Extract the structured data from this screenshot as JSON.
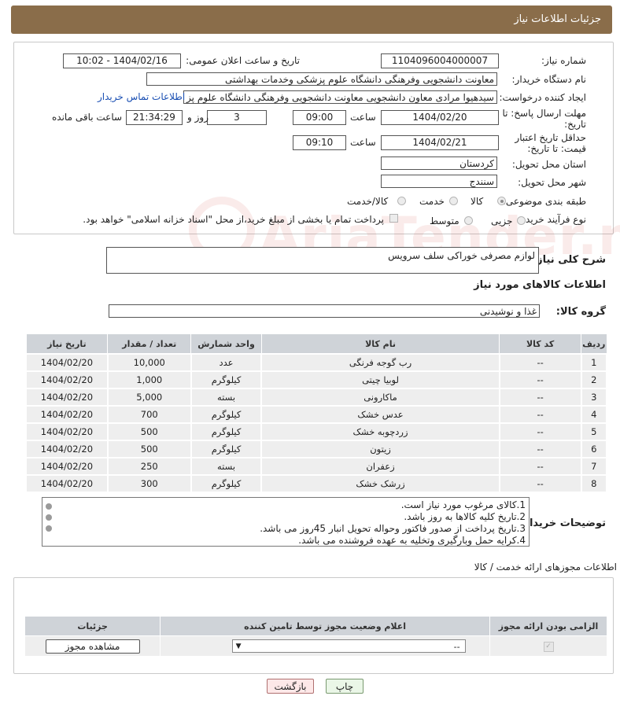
{
  "header": {
    "title": "جزئیات اطلاعات نیاز"
  },
  "form": {
    "need_number_label": "شماره نیاز:",
    "need_number": "1104096004000007",
    "announce_label": "تاریخ و ساعت اعلان عمومی:",
    "announce_value": "1404/02/16 - 10:02",
    "buyer_org_label": "نام دستگاه خریدار:",
    "buyer_org": "معاونت دانشجویی وفرهنگی دانشگاه علوم پزشکی وخدمات بهداشتی",
    "creator_label": "ایجاد کننده درخواست:",
    "creator": "سیدهیوا مرادی معاون دانشجویی معاونت دانشجویی وفرهنگی دانشگاه علوم پز",
    "contact_link": "اطلاعات تماس خریدار",
    "reply_deadline_label": "مهلت ارسال پاسخ: تا تاریخ:",
    "reply_date": "1404/02/20",
    "time_label": "ساعت",
    "reply_time": "09:00",
    "days": "3",
    "days_label": "روز و",
    "remaining_time": "21:34:29",
    "remaining_label": "ساعت باقی مانده",
    "price_validity_label": "حداقل تاریخ اعتبار قیمت: تا تاریخ:",
    "price_date": "1404/02/21",
    "price_time": "09:10",
    "province_label": "استان محل تحویل:",
    "province": "کردستان",
    "city_label": "شهر محل تحویل:",
    "city": "سنندج",
    "category_label": "طبقه بندی موضوعی:",
    "category_options": [
      "کالا",
      "خدمت",
      "کالا/خدمت"
    ],
    "process_label": "نوع فرآیند خرید :",
    "process_options": [
      "جزیی",
      "متوسط"
    ],
    "payment_note": "پرداخت تمام یا بخشی از مبلغ خرید،از محل \"اسناد خزانه اسلامی\" خواهد بود.",
    "watermark": "AriaTender.neT"
  },
  "summary": {
    "label": "شرح کلی نیاز:",
    "value": "لوازم مصرفی خوراکی سلف سرویس",
    "goods_info_title": "اطلاعات کالاهای مورد نیاز",
    "group_label": "گروه کالا:",
    "group_value": "غذا و نوشیدنی"
  },
  "items_table": {
    "headers": [
      "ردیف",
      "کد کالا",
      "نام کالا",
      "واحد شمارش",
      "تعداد / مقدار",
      "تاریخ نیاز"
    ],
    "rows": [
      [
        "1",
        "--",
        "رب گوجه فرنگی",
        "عدد",
        "10,000",
        "1404/02/20"
      ],
      [
        "2",
        "--",
        "لوبیا چیتی",
        "کیلوگرم",
        "1,000",
        "1404/02/20"
      ],
      [
        "3",
        "--",
        "ماکارونی",
        "بسته",
        "5,000",
        "1404/02/20"
      ],
      [
        "4",
        "--",
        "عدس خشک",
        "کیلوگرم",
        "700",
        "1404/02/20"
      ],
      [
        "5",
        "--",
        "زردچوبه خشک",
        "کیلوگرم",
        "500",
        "1404/02/20"
      ],
      [
        "6",
        "--",
        "زیتون",
        "کیلوگرم",
        "500",
        "1404/02/20"
      ],
      [
        "7",
        "--",
        "زعفران",
        "بسته",
        "250",
        "1404/02/20"
      ],
      [
        "8",
        "--",
        "زرشک خشک",
        "کیلوگرم",
        "300",
        "1404/02/20"
      ]
    ]
  },
  "buyer_notes": {
    "label": "توضیحات خریدار:",
    "lines": [
      "1.کالای مرغوب مورد نیاز است.",
      "2.تاریخ کلیه کالاها به روز باشد.",
      "3.تاریخ پرداخت از صدور فاکتور وحواله تحویل انبار 45روز می باشد.",
      "4.کرایه حمل وبارگیری وتخلیه به عهده فروشنده می باشد."
    ]
  },
  "licenses": {
    "title": "اطلاعات مجوزهای ارائه خدمت / کالا",
    "headers": [
      "الزامی بودن ارائه مجوز",
      "اعلام وضعیت مجوز توسط تامین کننده",
      "جزئیات"
    ],
    "select_value": "--",
    "view_button": "مشاهده مجوز"
  },
  "buttons": {
    "print": "چاپ",
    "back": "بازگشت"
  }
}
